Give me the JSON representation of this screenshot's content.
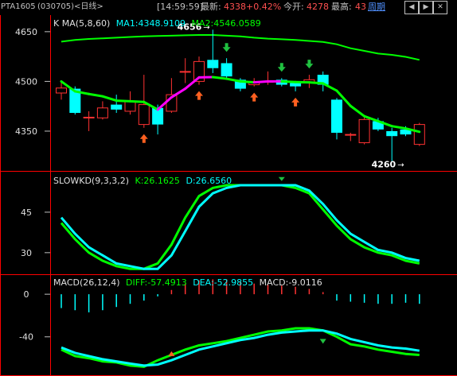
{
  "topbar": {
    "symbol": "PTA1605",
    "code_period": "(030705)<日线>",
    "time": "[14:59:59]",
    "latest_label": "最新:",
    "latest_value": "4338",
    "change_pct": "+0.42%",
    "open_label": "今开:",
    "open_value": "4278",
    "high_label": "最高:",
    "high_value": "43",
    "period_label": "周期"
  },
  "price_panel": {
    "title": "K  MA(5,8,60)",
    "ma1": "MA1:4348.9109",
    "ma2": "MA2:4546.0589",
    "y_ticks": [
      "4650",
      "4500",
      "4350"
    ],
    "annotation_high": "4656",
    "annotation_low": "4260"
  },
  "kd_panel": {
    "title": "SLOWKD(9,3,3,2)",
    "k": "K:26.1625",
    "d": "D:26.6560",
    "y_ticks": [
      "45",
      "30"
    ]
  },
  "macd_panel": {
    "title": "MACD(26,12,4)",
    "diff": "DIFF:-57.4913",
    "dea": "DEA:-52.9855",
    "macd": "MACD:-9.0116",
    "y_ticks": [
      "0",
      "-40"
    ]
  },
  "colors": {
    "up": "#ff3232",
    "down": "#00ffff",
    "ma_slow": "#00ff00",
    "ma_fast_up": "#ff00ff",
    "ma_fast_down": "#00ff00",
    "frame": "#ff0000",
    "axis": "#c0c0c0"
  },
  "chart_data": [
    {
      "type": "candlestick",
      "ylim": [
        4230,
        4700
      ],
      "y_ticks": [
        4650,
        4500,
        4350
      ],
      "candles": [
        {
          "o": 4465,
          "c": 4480,
          "h": 4500,
          "l": 4445
        },
        {
          "o": 4478,
          "c": 4405,
          "h": 4485,
          "l": 4400
        },
        {
          "o": 4390,
          "c": 4392,
          "h": 4410,
          "l": 4350
        },
        {
          "o": 4390,
          "c": 4420,
          "h": 4440,
          "l": 4385
        },
        {
          "o": 4430,
          "c": 4415,
          "h": 4460,
          "l": 4405
        },
        {
          "o": 4410,
          "c": 4440,
          "h": 4470,
          "l": 4400
        },
        {
          "o": 4370,
          "c": 4430,
          "h": 4520,
          "l": 4360
        },
        {
          "o": 4420,
          "c": 4370,
          "h": 4430,
          "l": 4340
        },
        {
          "o": 4410,
          "c": 4460,
          "h": 4510,
          "l": 4405
        },
        {
          "o": 4530,
          "c": 4530,
          "h": 4570,
          "l": 4495
        },
        {
          "o": 4500,
          "c": 4560,
          "h": 4575,
          "l": 4490
        },
        {
          "o": 4565,
          "c": 4540,
          "h": 4656,
          "l": 4525
        },
        {
          "o": 4555,
          "c": 4515,
          "h": 4570,
          "l": 4505
        },
        {
          "o": 4505,
          "c": 4478,
          "h": 4510,
          "l": 4470
        },
        {
          "o": 4490,
          "c": 4500,
          "h": 4510,
          "l": 4485
        },
        {
          "o": 4500,
          "c": 4500,
          "h": 4530,
          "l": 4490
        },
        {
          "o": 4505,
          "c": 4490,
          "h": 4510,
          "l": 4485
        },
        {
          "o": 4495,
          "c": 4485,
          "h": 4500,
          "l": 4470
        },
        {
          "o": 4495,
          "c": 4505,
          "h": 4520,
          "l": 4480
        },
        {
          "o": 4520,
          "c": 4490,
          "h": 4530,
          "l": 4470
        },
        {
          "o": 4445,
          "c": 4345,
          "h": 4450,
          "l": 4325
        },
        {
          "o": 4340,
          "c": 4340,
          "h": 4345,
          "l": 4320
        },
        {
          "o": 4315,
          "c": 4385,
          "h": 4395,
          "l": 4310
        },
        {
          "o": 4380,
          "c": 4355,
          "h": 4390,
          "l": 4350
        },
        {
          "o": 4350,
          "c": 4335,
          "h": 4360,
          "l": 4260
        },
        {
          "o": 4355,
          "c": 4340,
          "h": 4365,
          "l": 4335
        },
        {
          "o": 4310,
          "c": 4370,
          "h": 4375,
          "l": 4305
        }
      ],
      "ma_slow": [
        4620,
        4625,
        4628,
        4630,
        4632,
        4634,
        4636,
        4637,
        4638,
        4639,
        4640,
        4640,
        4638,
        4636,
        4632,
        4629,
        4627,
        4625,
        4622,
        4619,
        4612,
        4600,
        4592,
        4584,
        4580,
        4574,
        4565
      ],
      "ma_fast": [
        4500,
        4470,
        4462,
        4455,
        4442,
        4440,
        4438,
        4415,
        4452,
        4478,
        4512,
        4513,
        4508,
        4500,
        4497,
        4500,
        4500,
        4498,
        4497,
        4494,
        4472,
        4426,
        4395,
        4380,
        4365,
        4358,
        4348
      ],
      "up_arrows": [
        6,
        10,
        14,
        17
      ],
      "down_arrows": [
        12,
        16,
        18
      ]
    },
    {
      "type": "line",
      "ylim": [
        22,
        60
      ],
      "y_ticks": [
        45,
        30
      ],
      "series": [
        {
          "values": [
            41,
            35,
            30,
            27,
            25,
            24,
            24,
            26,
            33,
            43,
            51,
            54,
            55,
            55,
            55,
            55,
            55,
            54,
            52,
            46,
            40,
            35,
            32,
            30,
            29,
            27,
            26
          ]
        },
        {
          "values": [
            43,
            37,
            32,
            29,
            26,
            25,
            24,
            24,
            29,
            38,
            47,
            52,
            54,
            55,
            55,
            55,
            55,
            55,
            53,
            48,
            42,
            37,
            34,
            31,
            30,
            28,
            27
          ]
        }
      ]
    },
    {
      "type": "line",
      "ylim": [
        -76,
        18
      ],
      "y_ticks": [
        0,
        -40
      ],
      "macd_bars": [
        -13,
        -15,
        -17,
        -15,
        -12,
        -9,
        -6,
        -2,
        4,
        10,
        13,
        14,
        14,
        12,
        10,
        9,
        8,
        7,
        5,
        2,
        -6,
        -7,
        -8,
        -9,
        -9,
        -8,
        -9
      ],
      "series": [
        {
          "values": [
            -52,
            -58,
            -60,
            -63,
            -64,
            -67,
            -68,
            -62,
            -57,
            -52,
            -48,
            -46,
            -44,
            -41,
            -38,
            -35,
            -34,
            -32,
            -32,
            -34,
            -40,
            -47,
            -49,
            -52,
            -54,
            -56,
            -57
          ]
        },
        {
          "values": [
            -50,
            -55,
            -58,
            -61,
            -63,
            -65,
            -67,
            -66,
            -62,
            -57,
            -52,
            -49,
            -46,
            -43,
            -41,
            -38,
            -36,
            -35,
            -34,
            -34,
            -37,
            -42,
            -45,
            -48,
            -50,
            -51,
            -53
          ]
        }
      ]
    }
  ]
}
